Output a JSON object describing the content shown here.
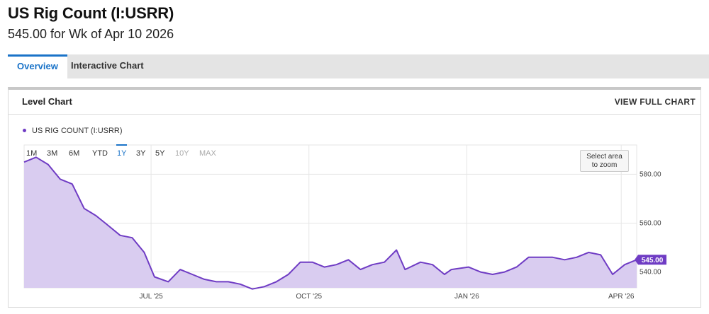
{
  "header": {
    "title": "US Rig Count (I:USRR)",
    "subtitle": "545.00 for Wk of Apr 10 2026"
  },
  "tabs": [
    {
      "label": "Overview",
      "active": true
    },
    {
      "label": "Interactive Chart",
      "active": false
    }
  ],
  "card": {
    "title": "Level Chart",
    "view_full_label": "VIEW FULL CHART"
  },
  "legend": {
    "label": "US RIG COUNT (I:USRR)",
    "color": "#6f3cc4"
  },
  "ranges": [
    {
      "label": "1M",
      "active": false,
      "disabled": false
    },
    {
      "label": "3M",
      "active": false,
      "disabled": false
    },
    {
      "label": "6M",
      "active": false,
      "disabled": false
    },
    {
      "label": "YTD",
      "active": false,
      "disabled": false
    },
    {
      "label": "1Y",
      "active": true,
      "disabled": false
    },
    {
      "label": "3Y",
      "active": false,
      "disabled": false
    },
    {
      "label": "5Y",
      "active": false,
      "disabled": false
    },
    {
      "label": "10Y",
      "active": false,
      "disabled": true
    },
    {
      "label": "MAX",
      "active": false,
      "disabled": true
    }
  ],
  "zoom_hint": {
    "line1": "Select area",
    "line2": "to zoom"
  },
  "chart_data": {
    "type": "area",
    "series": [
      {
        "name": "US RIG COUNT (I:USRR)",
        "color": "#6f3cc4",
        "fill": "#d9ccf0",
        "x": [
          "2025-04-18",
          "2025-04-25",
          "2025-05-02",
          "2025-05-09",
          "2025-05-16",
          "2025-05-23",
          "2025-05-30",
          "2025-06-06",
          "2025-06-13",
          "2025-06-20",
          "2025-06-27",
          "2025-07-03",
          "2025-07-11",
          "2025-07-18",
          "2025-07-25",
          "2025-08-01",
          "2025-08-08",
          "2025-08-15",
          "2025-08-22",
          "2025-08-29",
          "2025-09-05",
          "2025-09-12",
          "2025-09-19",
          "2025-09-26",
          "2025-10-03",
          "2025-10-10",
          "2025-10-17",
          "2025-10-24",
          "2025-10-31",
          "2025-11-07",
          "2025-11-14",
          "2025-11-21",
          "2025-11-26",
          "2025-12-05",
          "2025-12-12",
          "2025-12-19",
          "2025-12-23",
          "2026-01-02",
          "2026-01-09",
          "2026-01-16",
          "2026-01-23",
          "2026-01-30",
          "2026-02-06",
          "2026-02-13",
          "2026-02-20",
          "2026-02-27",
          "2026-03-06",
          "2026-03-13",
          "2026-03-20",
          "2026-03-27",
          "2026-04-03",
          "2026-04-10"
        ],
        "values": [
          585,
          587,
          584,
          578,
          576,
          566,
          563,
          559,
          555,
          554,
          548,
          538,
          536,
          541,
          539,
          537,
          536,
          536,
          535,
          533,
          534,
          536,
          539,
          544,
          544,
          542,
          543,
          545,
          541,
          543,
          544,
          549,
          541,
          544,
          543,
          539,
          541,
          542,
          540,
          539,
          540,
          542,
          546,
          546,
          546,
          545,
          546,
          548,
          547,
          539,
          543,
          545
        ]
      }
    ],
    "y_ticks": [
      540,
      560,
      580
    ],
    "y_tick_labels": [
      "540.00",
      "560.00",
      "580.00"
    ],
    "ylim": [
      533.5,
      592
    ],
    "x_ticks": [
      {
        "date": "2025-07-01",
        "label": "JUL '25"
      },
      {
        "date": "2025-10-01",
        "label": "OCT '25"
      },
      {
        "date": "2026-01-01",
        "label": "JAN '26"
      },
      {
        "date": "2026-04-01",
        "label": "APR '26"
      }
    ],
    "last_value_label": "545.00",
    "grid": true,
    "legend_position": "top-left"
  }
}
